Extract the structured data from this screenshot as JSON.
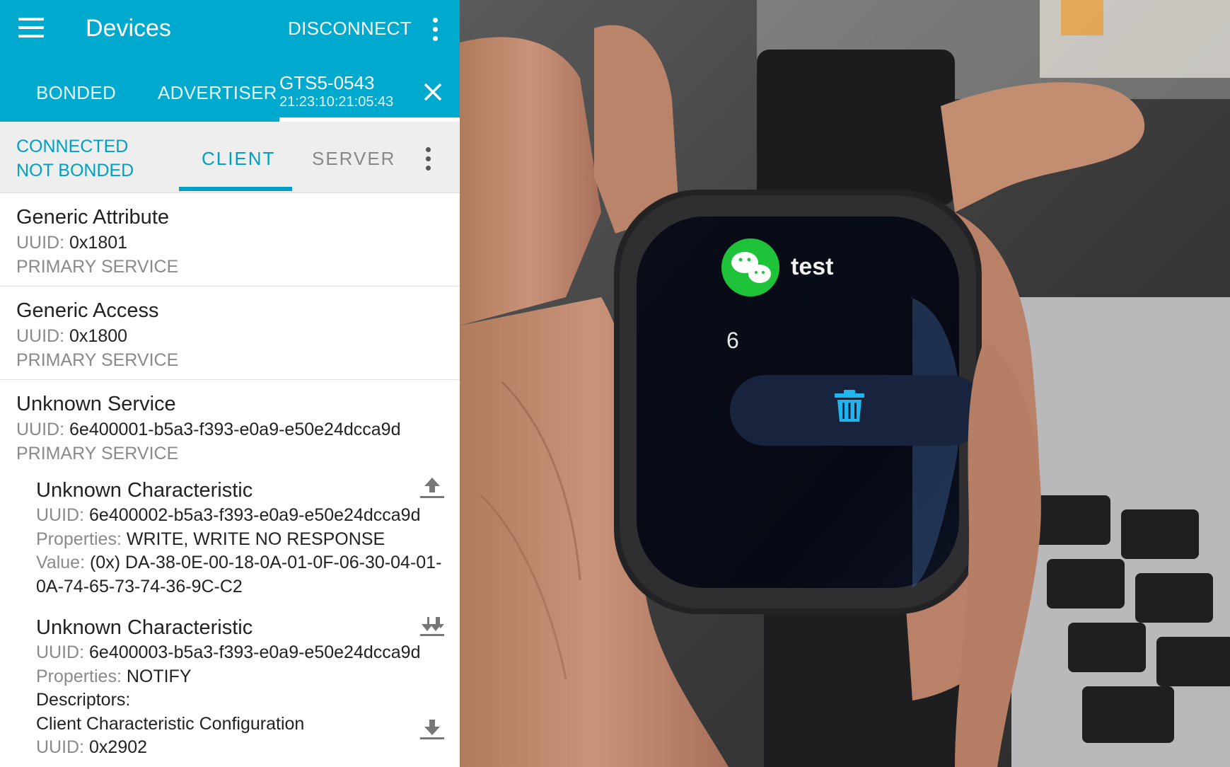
{
  "appbar": {
    "title": "Devices",
    "disconnect_label": "DISCONNECT"
  },
  "tabs": {
    "bonded": "BONDED",
    "advertiser": "ADVERTISER",
    "device_name": "GTS5-0543",
    "device_address": "21:23:10:21:05:43"
  },
  "connection": {
    "status_line1": "CONNECTED",
    "status_line2": "NOT BONDED",
    "client_tab": "CLIENT",
    "server_tab": "SERVER"
  },
  "labels": {
    "uuid": "UUID:",
    "properties": "Properties:",
    "value": "Value:",
    "descriptors": "Descriptors:"
  },
  "services": [
    {
      "name": "Generic Attribute",
      "uuid": "0x1801",
      "type": "PRIMARY SERVICE"
    },
    {
      "name": "Generic Access",
      "uuid": "0x1800",
      "type": "PRIMARY SERVICE"
    },
    {
      "name": "Unknown Service",
      "uuid": "6e400001-b5a3-f393-e0a9-e50e24dcca9d",
      "type": "PRIMARY SERVICE"
    }
  ],
  "characteristics": [
    {
      "name": "Unknown Characteristic",
      "uuid": "6e400002-b5a3-f393-e0a9-e50e24dcca9d",
      "properties": "WRITE, WRITE NO RESPONSE",
      "value": "(0x) DA-38-0E-00-18-0A-01-0F-06-30-04-01-0A-74-65-73-74-36-9C-C2",
      "action_icon": "upload-icon"
    },
    {
      "name": "Unknown Characteristic",
      "uuid": "6e400003-b5a3-f393-e0a9-e50e24dcca9d",
      "properties": "NOTIFY",
      "action_icon": "notify-icon",
      "descriptor": {
        "name": "Client Characteristic Configuration",
        "uuid": "0x2902",
        "action_icon": "download-icon"
      }
    }
  ],
  "watch_screen": {
    "app_icon": "wechat-icon",
    "title": "test",
    "message": "6",
    "delete_icon": "trash-icon"
  },
  "colors": {
    "appbar": "#00a9ce",
    "accent": "#00a0c6",
    "watch_icon_green": "#1fc339",
    "watch_trash": "#1fb6f0"
  }
}
